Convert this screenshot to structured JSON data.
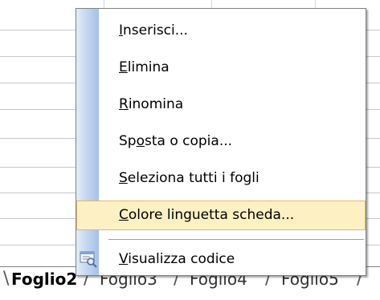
{
  "context_menu": {
    "items": [
      {
        "name": "insert",
        "mnemonic": "I",
        "rest": "nserisci...",
        "highlighted": false
      },
      {
        "name": "delete",
        "mnemonic": "E",
        "rest": "limina",
        "highlighted": false
      },
      {
        "name": "rename",
        "mnemonic": "R",
        "rest": "inomina",
        "highlighted": false
      },
      {
        "name": "move-copy",
        "pre": "Sp",
        "mnemonic": "o",
        "rest": "sta o copia...",
        "highlighted": false
      },
      {
        "name": "select-all",
        "mnemonic": "S",
        "rest": "eleziona tutti i fogli",
        "highlighted": false
      },
      {
        "name": "tab-color",
        "mnemonic": "C",
        "rest": "olore linguetta scheda...",
        "highlighted": true
      },
      {
        "name": "view-code",
        "mnemonic": "V",
        "rest": "isualizza codice",
        "highlighted": false,
        "icon": "view-code-icon"
      }
    ]
  },
  "sheet_tabs": {
    "tabs": [
      {
        "label": "Foglio2",
        "active": true
      },
      {
        "label": "Foglio3",
        "active": false
      },
      {
        "label": "Foglio4",
        "active": false
      },
      {
        "label": "Foglio5",
        "active": false
      }
    ]
  },
  "colors": {
    "highlight_bg": "#fdf1c4",
    "highlight_border": "#e3b56a",
    "gutter": "#c6d7f0"
  }
}
